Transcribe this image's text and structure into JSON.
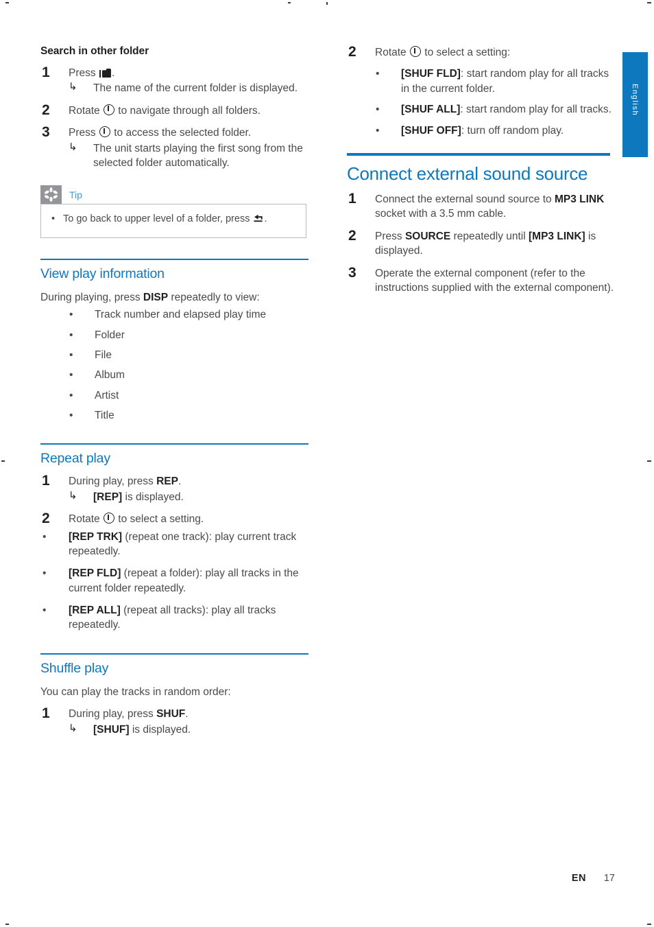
{
  "page": {
    "language_tab": "English",
    "footer": {
      "locale": "EN",
      "page_number": "17"
    }
  },
  "left_column": {
    "section_search": {
      "heading": "Search in other folder",
      "steps": [
        {
          "num": "1",
          "text_before": "Press ",
          "icon": "folder-glyph",
          "text_after": ".",
          "result": "The name of the current folder is displayed."
        },
        {
          "num": "2",
          "text_before": "Rotate ",
          "icon": "knob-glyph",
          "text_after": " to navigate through all folders."
        },
        {
          "num": "3",
          "text_before": "Press ",
          "icon": "knob-glyph",
          "text_after": " to access the selected folder.",
          "result": "The unit starts playing the first song from the selected folder automatically."
        }
      ]
    },
    "tip": {
      "label": "Tip",
      "icon": "asterisk-icon",
      "items": [
        {
          "text_before": "To go back to upper level of a folder, press ",
          "icon": "back-glyph",
          "text_after": "."
        }
      ]
    },
    "section_view": {
      "heading": "View play information",
      "intro_before": "During playing, press ",
      "intro_bold": "DISP",
      "intro_after": " repeatedly to view:",
      "items": [
        "Track number and elapsed play time",
        "Folder",
        "File",
        "Album",
        "Artist",
        "Title"
      ]
    },
    "section_repeat": {
      "heading": "Repeat play",
      "step1": {
        "num": "1",
        "text_before": "During play, press ",
        "bold": "REP",
        "text_after": ".",
        "result_bold": "[REP]",
        "result_after": " is displayed."
      },
      "step2": {
        "num": "2",
        "text_before": "Rotate ",
        "icon": "knob-glyph",
        "text_after": " to select a setting."
      },
      "options": [
        {
          "code": "[REP TRK]",
          "desc": " (repeat one track): play current track repeatedly."
        },
        {
          "code": "[REP FLD]",
          "desc": " (repeat a folder): play all tracks in the current folder repeatedly."
        },
        {
          "code": "[REP ALL]",
          "desc": " (repeat all tracks): play all tracks repeatedly."
        }
      ]
    },
    "section_shuffle": {
      "heading": "Shuffle play",
      "intro": "You can play the tracks in random order:",
      "step1": {
        "num": "1",
        "text_before": "During play, press ",
        "bold": "SHUF",
        "text_after": ".",
        "result_bold": "[SHUF]",
        "result_after": " is displayed."
      }
    }
  },
  "right_column": {
    "shuffle_continued": {
      "step2": {
        "num": "2",
        "text_before": "Rotate ",
        "icon": "knob-glyph",
        "text_after": " to select a setting:"
      },
      "options": [
        {
          "code": "[SHUF FLD]",
          "desc": ": start random play for all tracks in the current folder."
        },
        {
          "code": "[SHUF ALL]",
          "desc": ": start random play for all tracks."
        },
        {
          "code": "[SHUF OFF]",
          "desc": ": turn off random play."
        }
      ]
    },
    "section_connect": {
      "heading": "Connect external sound source",
      "steps": [
        {
          "num": "1",
          "before": "Connect the external sound source to ",
          "bold": "MP3 LINK",
          "after": " socket with a 3.5 mm cable."
        },
        {
          "num": "2",
          "before": "Press ",
          "bold": "SOURCE",
          "mid": " repeatedly until ",
          "bold2": "[MP3 LINK]",
          "after": " is displayed."
        },
        {
          "num": "3",
          "before": "Operate the external component (refer to the instructions supplied with the external component).",
          "bold": "",
          "after": ""
        }
      ]
    }
  },
  "colors": {
    "brand_blue": "#0d78bd",
    "tip_blue": "#3a9bd9",
    "tip_gray": "#939598",
    "body_text": "#4a4a4a",
    "heading_black": "#231f20"
  }
}
